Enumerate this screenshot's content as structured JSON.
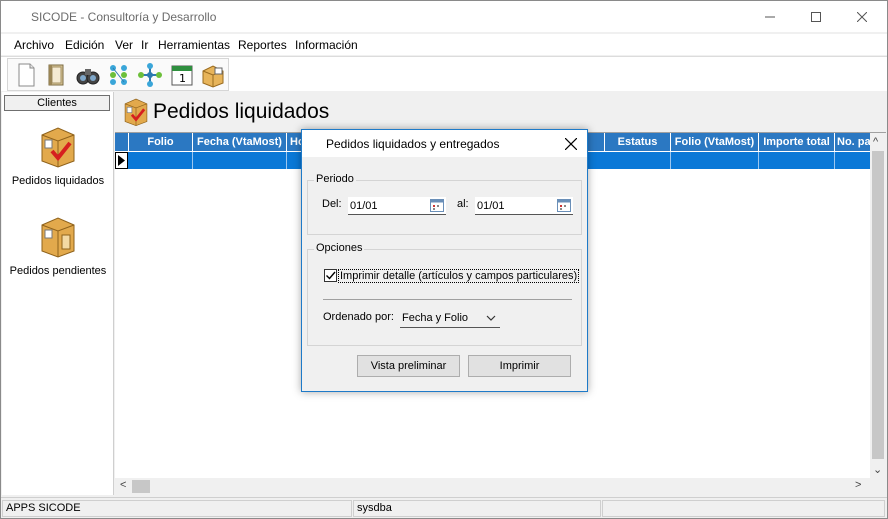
{
  "window": {
    "title": "SICODE - Consultoría y Desarrollo"
  },
  "menu": [
    "Archivo",
    "Edición",
    "Ver",
    "Ir",
    "Herramientas",
    "Reportes",
    "Información"
  ],
  "toolbar": {
    "icons": [
      "new-document-icon",
      "book-icon",
      "binoculars-icon",
      "grid-icon",
      "network-icon",
      "calendar-icon",
      "package-icon"
    ]
  },
  "sidebar": {
    "header": "Clientes",
    "items": [
      {
        "label": "Pedidos liquidados",
        "icon": "box-check-icon"
      },
      {
        "label": "Pedidos pendientes",
        "icon": "box-pending-icon"
      }
    ]
  },
  "main": {
    "title": "Pedidos liquidados",
    "columns": [
      "Folio",
      "Fecha (VtaMost)",
      "Ho",
      "",
      "Estatus",
      "Folio (VtaMost)",
      "Importe total",
      "No. pa"
    ]
  },
  "dialog": {
    "title": "Pedidos liquidados y entregados",
    "periodo_label": "Periodo",
    "del_label": "Del:",
    "del_value": "01/01",
    "al_label": "al:",
    "al_value": "01/01",
    "opciones_label": "Opciones",
    "detalle_label": "Imprimir detalle (artículos y campos particulares)",
    "detalle_checked": true,
    "ordenado_label": "Ordenado por:",
    "ordenado_value": "Fecha y Folio",
    "preview_button": "Vista preliminar",
    "print_button": "Imprimir"
  },
  "status": {
    "app": "APPS SICODE",
    "user": "sysdba"
  },
  "colors": {
    "grid_header": "#2b78c2",
    "selected_row": "#0a78d7",
    "dialog_border": "#1e7ac8"
  }
}
